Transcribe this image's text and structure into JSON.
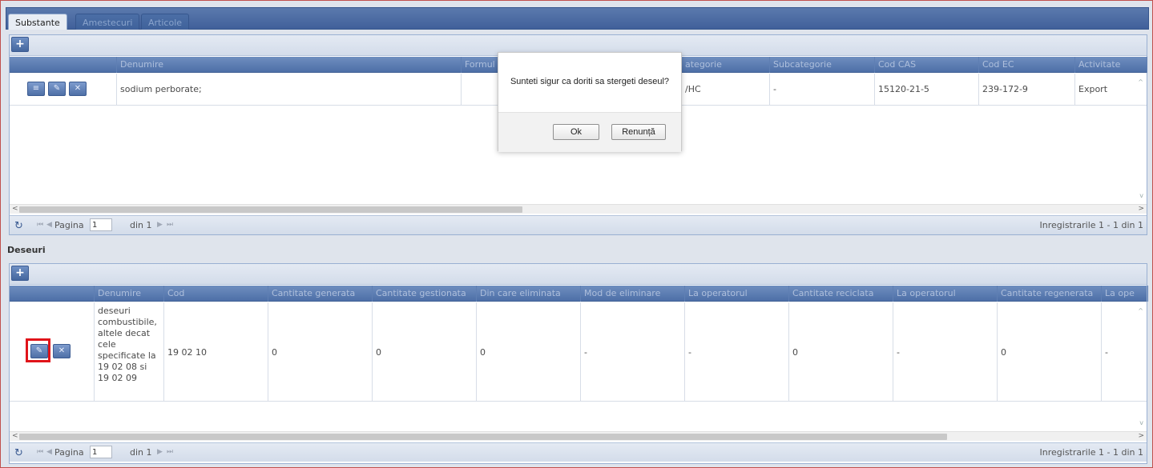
{
  "tabs": [
    {
      "label": "Substante",
      "active": true
    },
    {
      "label": "Amestecuri",
      "active": false
    },
    {
      "label": "Articole",
      "active": false
    }
  ],
  "substante": {
    "add_label": "+",
    "columns": [
      "Denumire",
      "Formul",
      "ategorie",
      "Subcategorie",
      "Cod CAS",
      "Cod EC",
      "Activitate"
    ],
    "rows": [
      {
        "denumire": "sodium perborate;",
        "formula": "",
        "categorie": "/HC",
        "subcategorie": "-",
        "cod_cas": "15120-21-5",
        "cod_ec": "239-172-9",
        "activitate": "Export"
      }
    ],
    "pager": {
      "page_label": "Pagina",
      "page_value": "1",
      "of_label": "din 1",
      "records": "Inregistrarile 1 - 1 din 1"
    }
  },
  "deseuri": {
    "title": "Deseuri",
    "add_label": "+",
    "columns": [
      "Denumire",
      "Cod",
      "Cantitate generata",
      "Cantitate gestionata",
      "Din care eliminata",
      "Mod de eliminare",
      "La operatorul",
      "Cantitate reciclata",
      "La operatorul",
      "Cantitate regenerata",
      "La ope"
    ],
    "rows": [
      {
        "denumire": "deseuri combustibile, altele decat cele specificate la 19 02 08 si 19 02 09",
        "cod": "19 02 10",
        "generata": "0",
        "gestionata": "0",
        "eliminata": "0",
        "mod": "-",
        "operator1": "-",
        "reciclata": "0",
        "operator2": "-",
        "regenerata": "0",
        "operator3": "-"
      }
    ],
    "pager": {
      "page_label": "Pagina",
      "page_value": "1",
      "of_label": "din 1",
      "records": "Inregistrarile 1 - 1 din 1"
    }
  },
  "dialog": {
    "message": "Sunteti sigur ca doriti sa stergeti deseul?",
    "ok_label": "Ok",
    "cancel_label": "Renunță"
  },
  "colors": {
    "header_blue": "#4d6fa7",
    "highlight_red": "#e0141a"
  },
  "icons": {
    "refresh": "refresh-icon",
    "first": "first-page-icon",
    "prev": "prev-page-icon",
    "next": "next-page-icon",
    "last": "last-page-icon"
  }
}
